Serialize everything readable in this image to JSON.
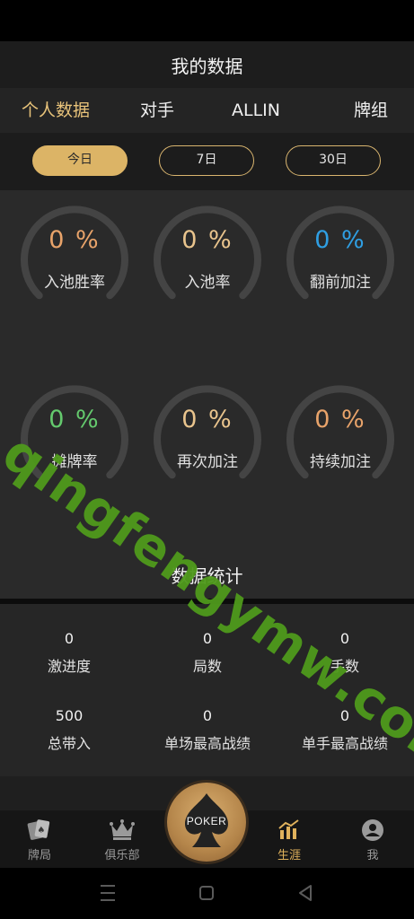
{
  "header": {
    "title": "我的数据"
  },
  "tabs": [
    {
      "label": "个人数据",
      "active": true
    },
    {
      "label": "对手",
      "active": false
    },
    {
      "label": "ALLIN",
      "active": false
    },
    {
      "label": "牌组",
      "active": false
    }
  ],
  "periods": [
    {
      "label": "今日",
      "active": true
    },
    {
      "label": "7日",
      "active": false
    },
    {
      "label": "30日",
      "active": false
    }
  ],
  "rings": [
    {
      "value": "0 %",
      "label": "入池胜率",
      "color": "#e8a36a"
    },
    {
      "value": "0 %",
      "label": "入池率",
      "color": "#e9c48d"
    },
    {
      "value": "0 %",
      "label": "翻前加注",
      "color": "#2f9fe3"
    },
    {
      "value": "0 %",
      "label": "摊牌率",
      "color": "#64c96d"
    },
    {
      "value": "0 %",
      "label": "再次加注",
      "color": "#e9c48d"
    },
    {
      "value": "0 %",
      "label": "持续加注",
      "color": "#e8a36a"
    }
  ],
  "stats": {
    "title": "数据统计",
    "items": [
      {
        "value": "0",
        "label": "激进度"
      },
      {
        "value": "0",
        "label": "局数"
      },
      {
        "value": "0",
        "label": "手数"
      },
      {
        "value": "500",
        "label": "总带入"
      },
      {
        "value": "0",
        "label": "单场最高战绩"
      },
      {
        "value": "0",
        "label": "单手最高战绩"
      }
    ]
  },
  "bottom_nav": [
    {
      "label": "牌局",
      "icon": "cards-icon",
      "active": false
    },
    {
      "label": "俱乐部",
      "icon": "crown-icon",
      "active": false
    },
    {
      "label": "生涯",
      "icon": "chart-icon",
      "active": true
    },
    {
      "label": "我",
      "icon": "user-icon",
      "active": false
    }
  ],
  "center_button": {
    "label": "POKER",
    "icon": "spade-icon"
  },
  "watermark": "qingfengymw.com",
  "colors": {
    "accent": "#dcb466",
    "background": "#2a2a2a"
  }
}
